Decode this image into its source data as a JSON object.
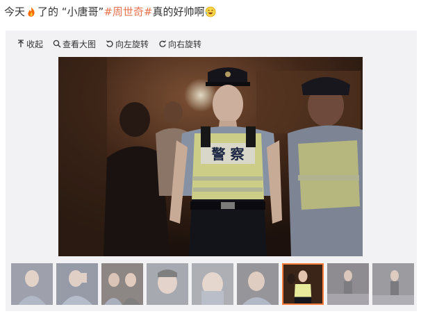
{
  "post": {
    "text_part1": "今天",
    "text_part2": "了的 “小唐哥”",
    "hashtag": "#周世奇#",
    "text_part3": " 真的好帅啊",
    "fire_icon": "fire-emoji-icon",
    "laugh_icon": "laughing-emoji-icon"
  },
  "toolbar": {
    "collapse": "收起",
    "view_large": "查看大图",
    "rotate_left": "向左旋转",
    "rotate_right": "向右旋转"
  },
  "photo": {
    "vest_text": "警 察",
    "icon": "police-officer-photo"
  },
  "thumbnails": {
    "count": 9,
    "active_index": 6
  },
  "colors": {
    "hashtag": "#eb7350",
    "panel_bg": "#f2f2f5",
    "active_border": "#fa7d3c",
    "vest": "#e6ea9a"
  }
}
